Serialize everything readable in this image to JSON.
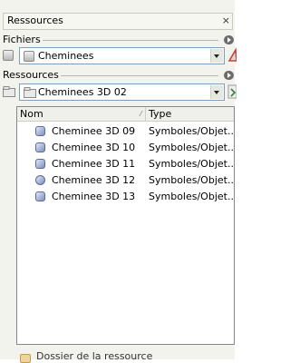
{
  "panel": {
    "title": "Ressources",
    "close_glyph": "×"
  },
  "fichiers": {
    "label": "Fichiers",
    "combo_value": "Cheminees",
    "icons": [
      "file-icon",
      "dropdown-arrow-icon",
      "delete-icon"
    ]
  },
  "ressources": {
    "label": "Ressources",
    "combo_value": "Cheminees 3D 02",
    "icons": [
      "folder-icon",
      "dropdown-arrow-icon",
      "up-icon"
    ]
  },
  "list": {
    "columns": [
      "Nom",
      "Type"
    ],
    "items": [
      {
        "name": "Cheminee 3D 09",
        "type": "Symboles/Objet..."
      },
      {
        "name": "Cheminee 3D 10",
        "type": "Symboles/Objet..."
      },
      {
        "name": "Cheminee 3D 11",
        "type": "Symboles/Objet..."
      },
      {
        "name": "Cheminee 3D 12",
        "type": "Symboles/Objet..."
      },
      {
        "name": "Cheminee 3D 13",
        "type": "Symboles/Objet..."
      }
    ]
  },
  "footer": {
    "label": "Dossier de la ressource"
  }
}
